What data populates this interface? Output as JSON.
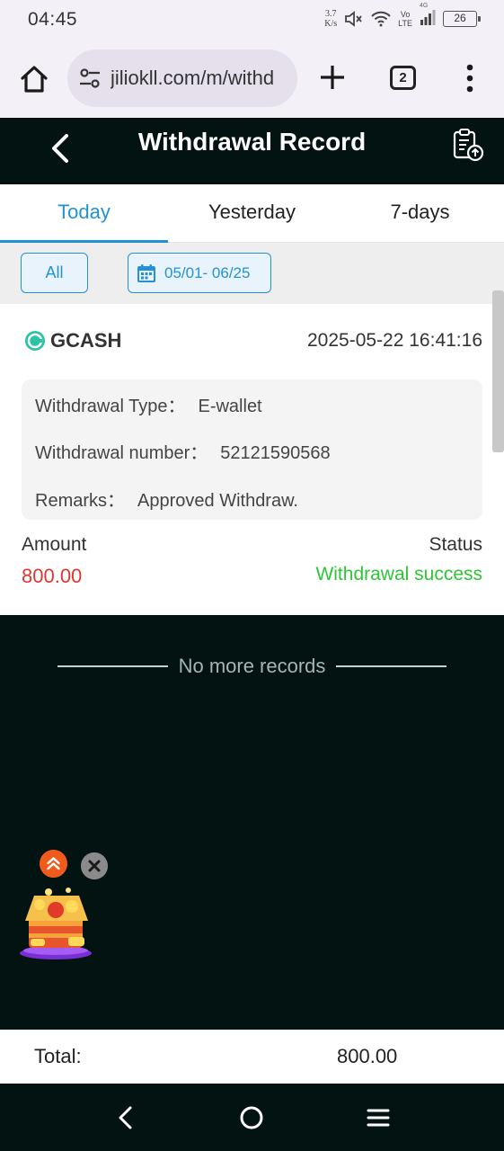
{
  "status_bar": {
    "time": "04:45",
    "net_speed_value": "3.7",
    "net_speed_unit": "K/s",
    "volte_top": "Vo",
    "volte_bottom": "LTE",
    "network_type": "4G",
    "battery": "26"
  },
  "browser": {
    "url": "jiliokll.com/m/withd",
    "tab_count": "2",
    "icons": [
      "home-icon",
      "tune-icon",
      "plus-icon",
      "more-vert-icon"
    ]
  },
  "header": {
    "title": "Withdrawal Record",
    "icons": [
      "back-icon",
      "clipboard-upload-icon"
    ]
  },
  "tabs": [
    {
      "label": "Today",
      "active": true
    },
    {
      "label": "Yesterday",
      "active": false
    },
    {
      "label": "7-days",
      "active": false
    }
  ],
  "filters": {
    "all_label": "All",
    "date_range": "05/01- 06/25"
  },
  "records": [
    {
      "method": "GCASH",
      "datetime": "2025-05-22 16:41:16",
      "type_label": "Withdrawal Type：",
      "type_value": "E-wallet",
      "number_label": "Withdrawal number：",
      "number_value": "52121590568",
      "remarks_label": "Remarks：",
      "remarks_value": "Approved Withdraw.",
      "amount_label": "Amount",
      "amount_value": "800.00",
      "status_label": "Status",
      "status_value": "Withdrawal success"
    }
  ],
  "no_more_text": "No more records",
  "total": {
    "label": "Total:",
    "value": "800.00"
  },
  "colors": {
    "accent": "#2491d6",
    "header_bg": "#021312",
    "amount": "#e2352f",
    "success": "#2cc536"
  }
}
